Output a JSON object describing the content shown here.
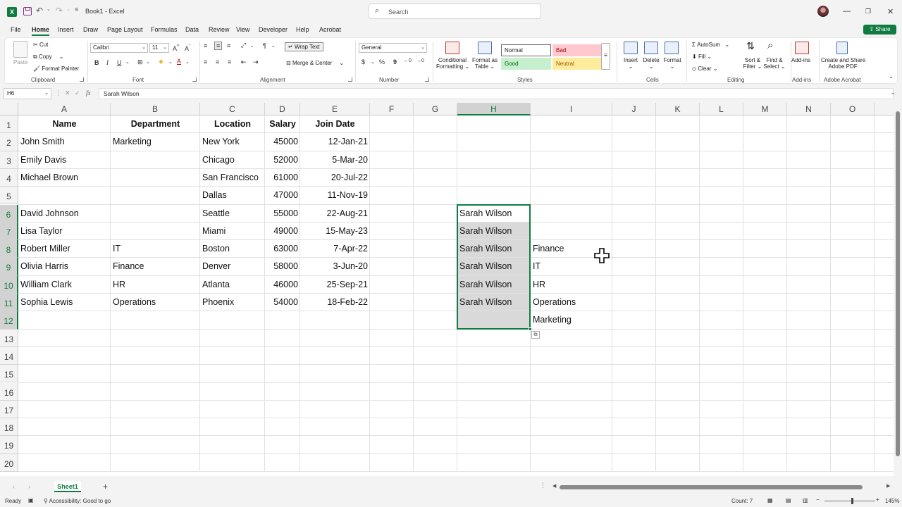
{
  "titlebar": {
    "doc_title": "Book1  -  Excel",
    "search_placeholder": "Search"
  },
  "menu": {
    "tabs": [
      "File",
      "Home",
      "Insert",
      "Draw",
      "Page Layout",
      "Formulas",
      "Data",
      "Review",
      "View",
      "Developer",
      "Help",
      "Acrobat"
    ],
    "active": "Home",
    "share_label": "Share"
  },
  "ribbon": {
    "clipboard": {
      "paste": "Paste",
      "cut": "Cut",
      "copy": "Copy",
      "format_painter": "Format Painter",
      "label": "Clipboard"
    },
    "font": {
      "name": "Calibri",
      "size": "11",
      "label": "Font"
    },
    "alignment": {
      "wrap": "Wrap Text",
      "merge": "Merge & Center",
      "label": "Alignment"
    },
    "number": {
      "format": "General",
      "label": "Number"
    },
    "styles": {
      "conditional": "Conditional",
      "conditional2": "Formatting",
      "format_as": "Format as",
      "table": "Table",
      "normal": "Normal",
      "bad": "Bad",
      "good": "Good",
      "neutral": "Neutral",
      "label": "Styles"
    },
    "cells": {
      "insert": "Insert",
      "delete": "Delete",
      "format": "Format",
      "label": "Cells"
    },
    "editing": {
      "autosum": "AutoSum",
      "fill": "Fill",
      "clear": "Clear",
      "sort": "Sort &",
      "filter": "Filter",
      "find": "Find &",
      "select": "Select",
      "label": "Editing"
    },
    "addins": {
      "btn": "Add-ins",
      "label": "Add-ins"
    },
    "acrobat": {
      "line1": "Create and Share",
      "line2": "Adobe PDF",
      "label": "Adobe Acrobat"
    }
  },
  "formula_bar": {
    "name_box": "H6",
    "content": "Sarah Wilson",
    "fx": "fx"
  },
  "grid": {
    "columns": [
      "A",
      "B",
      "C",
      "D",
      "E",
      "F",
      "G",
      "H",
      "I",
      "J",
      "K",
      "L",
      "M",
      "N",
      "O"
    ],
    "rows": [
      "1",
      "2",
      "3",
      "4",
      "5",
      "6",
      "7",
      "8",
      "9",
      "10",
      "11",
      "12",
      "13",
      "14",
      "15",
      "16",
      "17",
      "18",
      "19",
      "20"
    ],
    "headers": [
      "Name",
      "Department",
      "Location",
      "Salary",
      "Join Date"
    ],
    "data": [
      [
        "John Smith",
        "Marketing",
        "New York",
        "45000",
        "12-Jan-21"
      ],
      [
        "Emily Davis",
        "",
        "Chicago",
        "52000",
        "5-Mar-20"
      ],
      [
        "Michael Brown",
        "",
        "San Francisco",
        "61000",
        "20-Jul-22"
      ],
      [
        "",
        "",
        "Dallas",
        "47000",
        "11-Nov-19"
      ],
      [
        "David Johnson",
        "",
        "Seattle",
        "55000",
        "22-Aug-21"
      ],
      [
        "Lisa Taylor",
        "",
        "Miami",
        "49000",
        "15-May-23"
      ],
      [
        "Robert Miller",
        "IT",
        "Boston",
        "63000",
        "7-Apr-22"
      ],
      [
        "Olivia Harris",
        "Finance",
        "Denver",
        "58000",
        "3-Jun-20"
      ],
      [
        "William Clark",
        "HR",
        "Atlanta",
        "46000",
        "25-Sep-21"
      ],
      [
        "Sophia Lewis",
        "Operations",
        "Phoenix",
        "54000",
        "18-Feb-22"
      ]
    ],
    "col_h": [
      "Sarah Wilson",
      "Sarah Wilson",
      "Sarah Wilson",
      "Sarah Wilson",
      "Sarah Wilson",
      "Sarah Wilson"
    ],
    "col_i": [
      "Finance",
      "IT",
      "HR",
      "Operations",
      "Marketing"
    ]
  },
  "sheets": {
    "active": "Sheet1",
    "add": "+"
  },
  "status": {
    "ready": "Ready",
    "accessibility": "Accessibility: Good to go",
    "count": "Count: 7",
    "zoom": "145%"
  }
}
